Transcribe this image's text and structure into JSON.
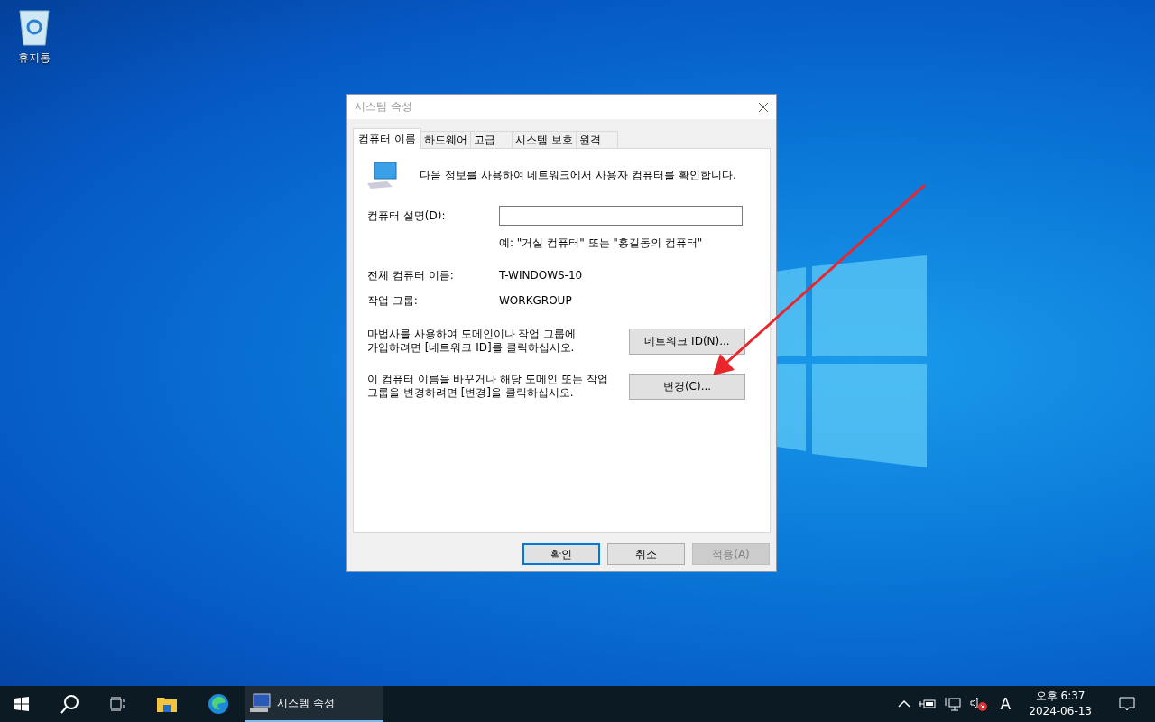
{
  "desktop": {
    "icons": [
      {
        "label": "휴지통"
      }
    ]
  },
  "dialog": {
    "title": "시스템 속성",
    "tabs": [
      {
        "label": "컴퓨터 이름",
        "selected": true
      },
      {
        "label": "하드웨어",
        "selected": false
      },
      {
        "label": "고급",
        "selected": false
      },
      {
        "label": "시스템 보호",
        "selected": false
      },
      {
        "label": "원격",
        "selected": false
      }
    ],
    "intro": "다음 정보를 사용하여 네트워크에서 사용자 컴퓨터를 확인합니다.",
    "description": {
      "label": "컴퓨터 설명(D):",
      "example": "예: \"거실 컴퓨터\" 또는 \"홍길동의 컴퓨터\""
    },
    "info": [
      {
        "label": "전체 컴퓨터 이름:",
        "value": "T-WINDOWS-10"
      },
      {
        "label": "작업 그룹:",
        "value": "WORKGROUP"
      }
    ],
    "actions": [
      {
        "text": "마법사를 사용하여 도메인이나 작업 그룹에\n가입하려면 [네트워크 ID]를 클릭하십시오.",
        "button": "네트워크 ID(N)..."
      },
      {
        "text": "이 컴퓨터 이름을 바꾸거나 해당 도메인 또는 작업\n그룹을 변경하려면 [변경]을 클릭하십시오.",
        "button": "변경(C)..."
      }
    ],
    "buttons": [
      {
        "label": "확인",
        "focused": true,
        "disabled": false
      },
      {
        "label": "취소",
        "focused": false,
        "disabled": false
      },
      {
        "label": "적용(A)",
        "focused": false,
        "disabled": true
      }
    ]
  },
  "taskbar": {
    "apps": [
      {
        "label": "시스템 속성"
      }
    ],
    "ime": "A",
    "clock": {
      "time": "오후 6:37",
      "date": "2024-06-13"
    }
  }
}
